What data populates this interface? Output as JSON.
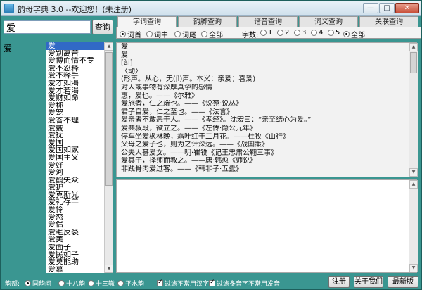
{
  "window": {
    "title": "韵母字典 3.0 --欢迎您！(未注册)"
  },
  "search": {
    "value": "爱",
    "button": "查询"
  },
  "tabs": [
    {
      "label": "字词查询",
      "active": true
    },
    {
      "label": "韵脚查询",
      "active": false
    },
    {
      "label": "谐音查询",
      "active": false
    },
    {
      "label": "词义查询",
      "active": false
    },
    {
      "label": "关联查询",
      "active": false
    }
  ],
  "position_options": [
    {
      "label": "词首",
      "selected": true
    },
    {
      "label": "词中",
      "selected": false
    },
    {
      "label": "词尾",
      "selected": false
    },
    {
      "label": "全部",
      "selected": false
    }
  ],
  "count_label": "字数:",
  "count_options": [
    {
      "label": "1",
      "selected": false
    },
    {
      "label": "2",
      "selected": false
    },
    {
      "label": "3",
      "selected": false
    },
    {
      "label": "4",
      "selected": false
    },
    {
      "label": "5",
      "selected": false
    },
    {
      "label": "全部",
      "selected": true
    }
  ],
  "left_head": "爱",
  "words": [
    "爱",
    "爱别离苦",
    "爱博而情不专",
    "爱不忍释",
    "爱不释手",
    "爱才如渴",
    "爱才若渴",
    "爱财如命",
    "爱称",
    "爱宠",
    "爱答不理",
    "爱戴",
    "爱抚",
    "爱国",
    "爱国如家",
    "爱国主义",
    "爱好",
    "爱河",
    "爱鹤失众",
    "爱护",
    "爱克斯光",
    "爱礼存羊",
    "爱怜",
    "爱恋",
    "爱侣",
    "爱毛反裘",
    "爱美",
    "爱面子",
    "爱民如子",
    "爱莫能助",
    "爱慕"
  ],
  "definition_lines": [
    "爱",
    "爱",
    "[ài]",
    "〈动〉",
    "(形声。从心，旡(jì)声。本义：亲爱；喜爱)",
    "对人或事物有深厚真挚的感情",
    "惠，爱也。——《尔雅》",
    "爱施者，仁之端也。——《说苑·说丛》",
    "君子自爱，仁之至也。——《法言》",
    "爱亲者不敢恶于人。——《孝经》。沈宏曰：“亲至结心为爱。”",
    "爱共叔段，欲立之。——《左传·隐公元年》",
    "停车坐爱枫林晚，霜叶红于二月花。——杜牧《山行》",
    "父母之爱子也，则为之计深远。——《战国策》",
    "公夫人甚爱女。——明·崔铣《记王忠肃公翱三事》",
    "爱其子，择师而教之。——唐·韩愈《师说》",
    "非践骨肉爱过客。——《韩非子·五蠹》"
  ],
  "note_text": "",
  "bottom": {
    "label": "韵部:",
    "rhyme_options": [
      {
        "label": "同韵间",
        "selected": true
      },
      {
        "label": "十八韵",
        "selected": false
      },
      {
        "label": "十三辙",
        "selected": false
      },
      {
        "label": "平水韵",
        "selected": false
      }
    ],
    "checkboxes": [
      {
        "label": "过滤不常用汉字",
        "checked": true
      },
      {
        "label": "过滤多音字不常用发音",
        "checked": true
      }
    ],
    "buttons": {
      "register": "注册",
      "about": "关于我们",
      "latest": "最新版>>"
    }
  }
}
